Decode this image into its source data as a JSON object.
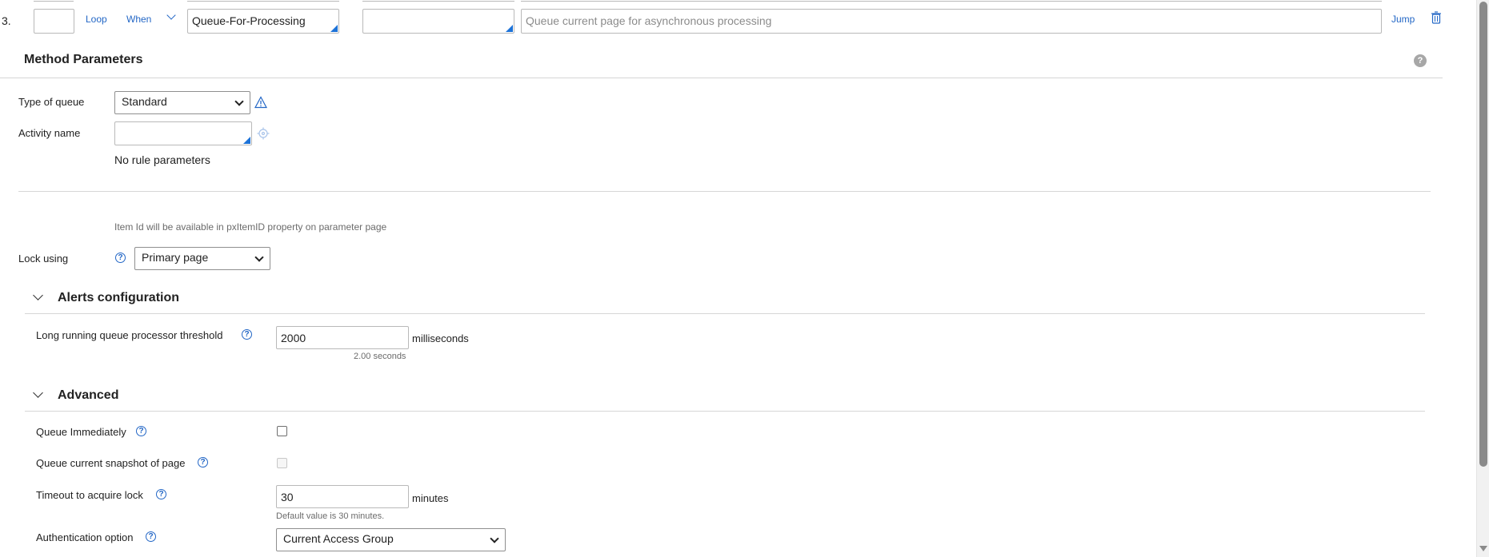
{
  "step_row": {
    "number": "3.",
    "loop_label": "Loop",
    "when_label": "When",
    "method_value": "Queue-For-Processing",
    "step_page_value": "",
    "description_placeholder": "Queue current page for asynchronous processing",
    "jump_label": "Jump"
  },
  "method_parameters": {
    "title": "Method Parameters",
    "type_of_queue_label": "Type of queue",
    "type_of_queue_value": "Standard",
    "activity_name_label": "Activity name",
    "activity_name_value": "",
    "no_rule_params": "No rule parameters",
    "item_id_hint": "Item Id will be available in pxItemID property on parameter page",
    "lock_using_label": "Lock using",
    "lock_using_value": "Primary page"
  },
  "alerts": {
    "title": "Alerts configuration",
    "threshold_label": "Long running queue processor threshold",
    "threshold_value": "2000",
    "threshold_unit": "milliseconds",
    "threshold_hint": "2.00 seconds"
  },
  "advanced": {
    "title": "Advanced",
    "queue_immediately_label": "Queue Immediately",
    "queue_immediately_checked": false,
    "queue_snapshot_label": "Queue current snapshot of page",
    "queue_snapshot_checked": false,
    "timeout_label": "Timeout to acquire lock",
    "timeout_value": "30",
    "timeout_unit": "minutes",
    "timeout_hint": "Default value is 30 minutes.",
    "auth_label": "Authentication option",
    "auth_value": "Current Access Group"
  },
  "icons": {
    "help": "?",
    "section_help": "?"
  },
  "colors": {
    "accent": "#2367c6",
    "corner_marker": "#1d73d8"
  }
}
